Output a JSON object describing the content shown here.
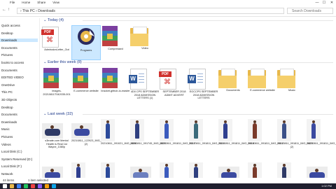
{
  "window": {
    "tabs": [
      "File",
      "Home",
      "Share",
      "View"
    ],
    "controls": [
      "—",
      "☐",
      "✕"
    ]
  },
  "address": {
    "path": "› This PC › Downloads",
    "search_placeholder": "Search Downloads"
  },
  "sidebar": [
    {
      "label": "Quick access",
      "sel": false
    },
    {
      "label": "Desktop",
      "sel": false
    },
    {
      "label": "Downloads",
      "sel": true
    },
    {
      "label": "Documents",
      "sel": false
    },
    {
      "label": "Pictures",
      "sel": false
    },
    {
      "label": "books to access",
      "sel": false
    },
    {
      "label": "Documents",
      "sel": false
    },
    {
      "label": "EDITED VIDEO",
      "sel": false
    },
    {
      "label": "OneDrive",
      "sel": false
    },
    {
      "label": "This PC",
      "sel": false
    },
    {
      "label": "3D Objects",
      "sel": false
    },
    {
      "label": "Desktop",
      "sel": false
    },
    {
      "label": "Documents",
      "sel": false
    },
    {
      "label": "Downloads",
      "sel": false
    },
    {
      "label": "Music",
      "sel": false
    },
    {
      "label": "Pictures",
      "sel": false
    },
    {
      "label": "Videos",
      "sel": false
    },
    {
      "label": "Local Disk (C:)",
      "sel": false
    },
    {
      "label": "System Reserved (D:)",
      "sel": false
    },
    {
      "label": "Local Disk (F:)",
      "sel": false
    },
    {
      "label": "Network",
      "sel": false
    }
  ],
  "groups": [
    {
      "title": "Today (4)",
      "items": [
        {
          "type": "pdf",
          "label": "AdmissionLetter_Out"
        },
        {
          "type": "program",
          "label": "Programs",
          "sel": true
        },
        {
          "type": "rar",
          "label": "Compressed"
        },
        {
          "type": "folder",
          "label": "Video"
        }
      ]
    },
    {
      "title": "Earlier this week (8)",
      "items": [
        {
          "type": "rar",
          "label": "images-20210811T042035-001"
        },
        {
          "type": "rar",
          "label": "E-commerce website"
        },
        {
          "type": "rar",
          "label": "bracket-github-io-master"
        },
        {
          "type": "docx",
          "label": "4D0 CPS SEPTEMBER 2018 ADMISSION LETTERS (1)"
        },
        {
          "type": "pdf",
          "label": "SEPTEMBER 2018 ADMIT ADVERT"
        },
        {
          "type": "docx",
          "label": "EGCCPS SEPTEMBER 2018 ADMISSION LETTERS"
        },
        {
          "type": "folder",
          "label": "Documents"
        },
        {
          "type": "folder",
          "label": "E-commerce website"
        },
        {
          "type": "folder",
          "label": "Music"
        }
      ]
    },
    {
      "title": "Last week (32)",
      "items": [
        {
          "type": "wide",
          "label": "s3mate.com Mental Health is Real 1st Wayne_1080p",
          "color": "#2f3a66"
        },
        {
          "type": "wide",
          "label": "20210811_122923_IMG_5828 (2)",
          "color": "#3b4aa0"
        },
        {
          "type": "thumb",
          "label": "20210811_091021_IMG_4086",
          "color": "#2c4a9a"
        },
        {
          "type": "thumb",
          "label": "20210811_091745_IMG_4020",
          "color": "#2e3f7f"
        },
        {
          "type": "thumb",
          "label": "20210811_091811_IMG_5017",
          "color": "#3b5bbd"
        },
        {
          "type": "thumb",
          "label": "20210811_091811_IMG_5015",
          "color": "#3b6a7a"
        },
        {
          "type": "thumb",
          "label": "20210811_091811_IMG_5918",
          "color": "#2f3f8f"
        },
        {
          "type": "thumb",
          "label": "20210811_091811_IMG_5912",
          "color": "#7a3a2a"
        },
        {
          "type": "thumb",
          "label": "20210811_091811_IMG_5823 (2)",
          "color": "#3b5088"
        },
        {
          "type": "thumb",
          "label": "20210811_091811_IMG_4071",
          "color": "#3b4aa0"
        }
      ]
    }
  ],
  "row4_colors": [
    "#3b4aa0",
    "#2f3f8f",
    "#2c4a9a",
    "#6b7fbf",
    "#3b5bbd",
    "#2e3f7f",
    "#3b4aa0",
    "#7a3a2a",
    "#2f3a66",
    "#3b4aa0"
  ],
  "status": {
    "count": "44 items",
    "selected": "1 item selected"
  },
  "taskbar": {
    "time": "1:02 PM",
    "icon_colors": [
      "#ffffff",
      "#e8b84a",
      "#3b82f6",
      "#22c55e",
      "#ef4444",
      "#8b5cf6",
      "#f59e0b",
      "#0ea5e9"
    ]
  }
}
